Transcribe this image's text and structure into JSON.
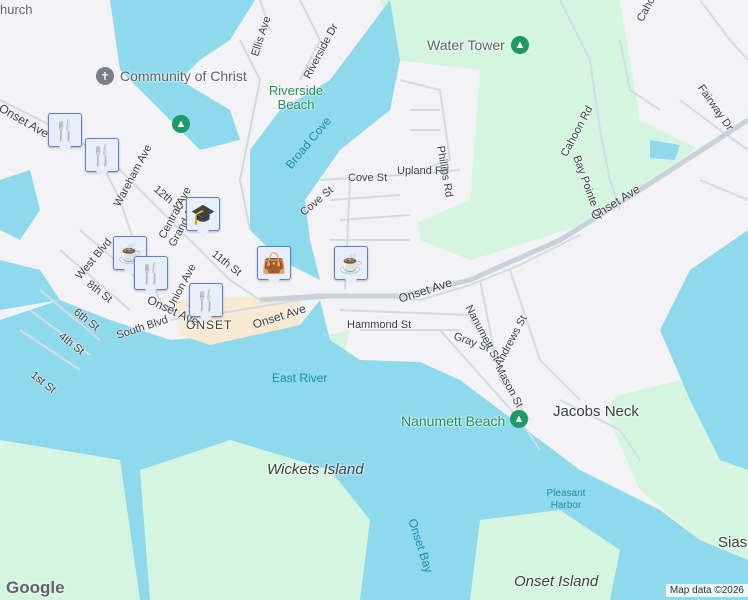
{
  "map": {
    "colors": {
      "land": "#f3f2f4",
      "water": "#8fd9ec",
      "park": "#d6f5e1",
      "road": "#d4dbe3",
      "highway": "#c8d2dc",
      "marker_bg": "#e8eefc",
      "marker_border": "#5b7fd6",
      "marker_icon": "#0d4b6e",
      "poi_park": "#1e9a6a"
    },
    "labels": {
      "church_partial": "hurch",
      "community_of_christ": "Community of Christ",
      "water_tower": "Water Tower",
      "riverside_beach": "Riverside Beach",
      "broad_cove": "Broad Cove",
      "ellis_ave": "Ellis Ave",
      "riverside_dr": "Riverside Dr",
      "onset_ave_w": "Onset Ave",
      "wareham_ave": "Wareham Ave",
      "twelfth_st": "12th St",
      "central_ave": "Central Ave",
      "grand_ave": "Grand Ave",
      "west_blvd": "West Blvd",
      "eleventh_st": "11th St",
      "eighth_st": "8th St",
      "sixth_st": "6th St",
      "fourth_st": "4th St",
      "first_st": "1st St",
      "union_ave": "Union Ave",
      "onset_ave_s": "Onset Ave",
      "south_blvd": "South Blvd",
      "onset": "ONSET",
      "onset_ave_c": "Onset Ave",
      "onset_ave_mid": "Onset Ave",
      "onset_ave_e": "Onset Ave",
      "cove_st": "Cove St",
      "cove_st2": "Cove St",
      "upland_rd": "Upland Rd",
      "phillips_rd": "Phillips Rd",
      "cahoon_rd": "Cahoon Rd",
      "cahoon_rd_top": "Cahoo",
      "bay_pointe_dr": "Bay Pointe Dr",
      "fairway_dr": "Fairway Dr",
      "hammond_st": "Hammond St",
      "gray_st": "Gray St",
      "nanumett_st": "Nanumett St",
      "andrews_st": "Andrews St",
      "mason_st": "Mason St",
      "east_river": "East River",
      "nanumett_beach": "Nanumett Beach",
      "jacobs_neck": "Jacobs Neck",
      "wickets_island": "Wickets Island",
      "pleasant_harbor": "Pleasant Harbor",
      "onset_bay": "Onset Bay",
      "onset_island": "Onset Island",
      "sias": "Sias"
    },
    "markers": [
      {
        "type": "restaurant",
        "icon": "🍴"
      },
      {
        "type": "restaurant",
        "icon": "🍴"
      },
      {
        "type": "school",
        "icon": "🎓"
      },
      {
        "type": "cafe",
        "icon": "☕"
      },
      {
        "type": "restaurant",
        "icon": "🍴"
      },
      {
        "type": "shopping",
        "icon": "👜"
      },
      {
        "type": "restaurant",
        "icon": "🍴"
      },
      {
        "type": "cafe",
        "icon": "☕"
      }
    ],
    "poi_icons": {
      "park": "▲",
      "church": "✝"
    },
    "logo": "Google",
    "attribution": "Map data ©2026"
  }
}
